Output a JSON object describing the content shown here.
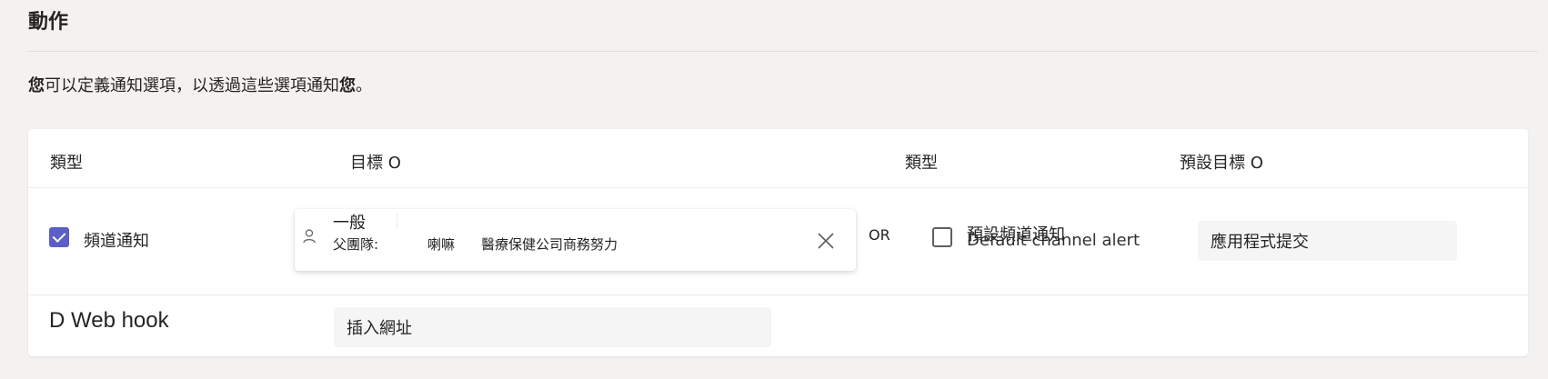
{
  "section": {
    "title": "動作",
    "description_bold_start": "您",
    "description_middle": "可以定義通知選項，以透過這些選項通知",
    "description_bold_end": "您",
    "description_end": "。"
  },
  "table": {
    "headers": {
      "type": "類型",
      "target": "目標 O",
      "type2": "類型",
      "default_target": "預設目標 O"
    },
    "row1": {
      "checkbox_checked": true,
      "checkbox_label": "頻道通知",
      "channel_name": "一般",
      "parent_team_label": "父團隊:",
      "parent_team_short": "喇嘛",
      "parent_team_name": "醫療保健公司商務努力",
      "or_label": "OR",
      "default_checkbox_checked": false,
      "default_checkbox_label": "預設頻道通知",
      "default_checkbox_overlay": "Default channel alert",
      "default_target_value": "應用程式提交"
    },
    "row2": {
      "label": "D Web hook",
      "input_placeholder": "插入網址"
    }
  },
  "colors": {
    "accent": "#5b5fc7",
    "background": "#f3f2f1",
    "card": "#ffffff"
  }
}
